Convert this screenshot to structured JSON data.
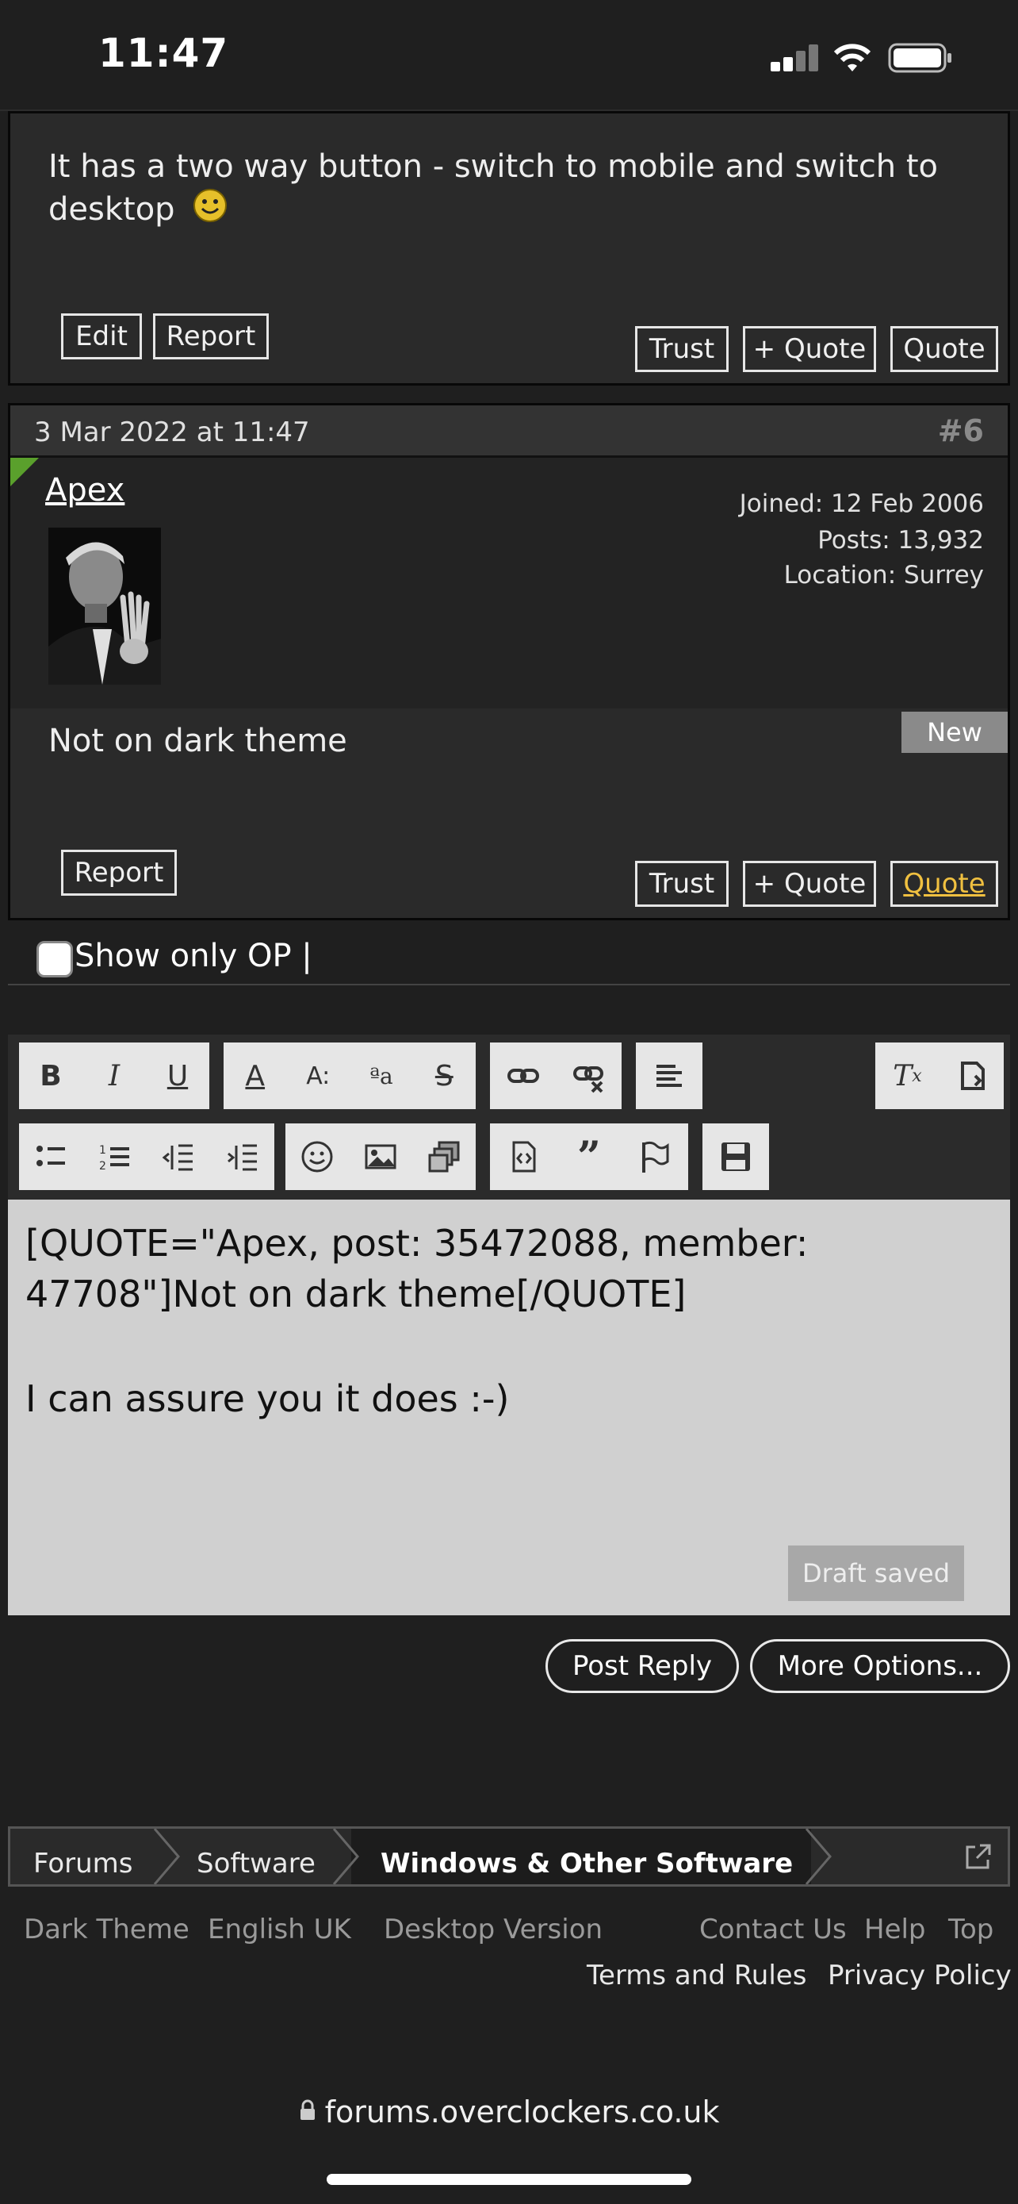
{
  "status_bar": {
    "time": "11:47"
  },
  "post5": {
    "body_text": "It has a two way button - switch to mobile and switch to desktop",
    "buttons": {
      "edit": "Edit",
      "report": "Report",
      "trust": "Trust",
      "plus_quote": "+ Quote",
      "quote": "Quote"
    }
  },
  "post6": {
    "date": "3 Mar 2022 at 11:47",
    "number": "#6",
    "author": "Apex",
    "joined": "Joined: 12 Feb 2006",
    "posts": "Posts: 13,932",
    "location": "Location: Surrey",
    "new_badge": "New",
    "body_text": "Not on dark theme",
    "buttons": {
      "report": "Report",
      "trust": "Trust",
      "plus_quote": "+ Quote",
      "quote": "Quote"
    }
  },
  "show_only_op": {
    "label": "Show only OP |",
    "checked": false
  },
  "editor": {
    "text_line1": "[QUOTE=\"Apex, post: 35472088, member:",
    "text_line2": "47708\"]Not on dark theme[/QUOTE]",
    "text_line3": "I can assure you it does :-)",
    "draft_status": "Draft saved",
    "toolbar_icons": [
      "bold-icon",
      "italic-icon",
      "underline-icon",
      "font-color-icon",
      "font-size-icon",
      "font-family-icon",
      "strikethrough-icon",
      "link-icon",
      "unlink-icon",
      "align-icon",
      "clear-format-icon",
      "toggle-bbcode-icon",
      "bullet-list-icon",
      "number-list-icon",
      "outdent-icon",
      "indent-icon",
      "smilie-icon",
      "image-icon",
      "media-icon",
      "insert-icon",
      "quote-icon",
      "spoiler-icon",
      "drafts-icon"
    ]
  },
  "actions": {
    "post_reply": "Post Reply",
    "more_options": "More Options..."
  },
  "breadcrumb": {
    "items": [
      "Forums",
      "Software",
      "Windows & Other Software"
    ]
  },
  "footer": {
    "dark_theme": "Dark Theme",
    "language": "English UK",
    "desktop_version": "Desktop Version",
    "contact_us": "Contact Us",
    "help": "Help",
    "top": "Top",
    "terms": "Terms and Rules",
    "privacy": "Privacy Policy"
  },
  "browser": {
    "url": "forums.overclockers.co.uk"
  },
  "colors": {
    "quote_accent": "#f0c040",
    "editor_bg": "#d0d0d0",
    "page_bg": "#1f1f1f"
  }
}
